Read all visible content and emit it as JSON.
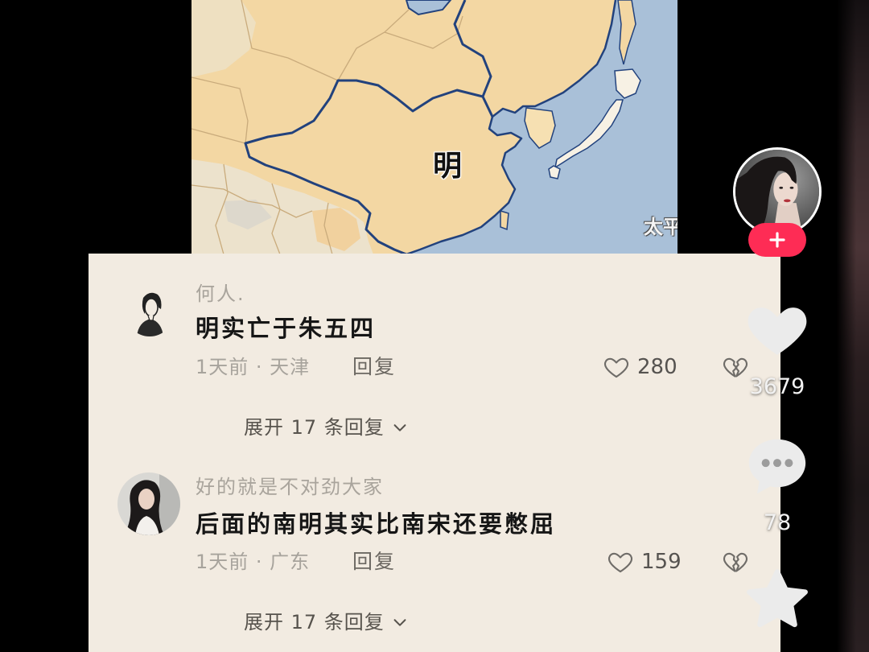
{
  "map": {
    "labels": {
      "ming": "明",
      "pacific": "太平"
    },
    "colors": {
      "land": "#f3d7a3",
      "sea": "#a9c0d8",
      "border": "#22427d"
    }
  },
  "creator": {
    "avatar_icon": "creator-avatar",
    "follow_icon": "plus-icon"
  },
  "sidebar": {
    "like": {
      "icon": "heart-icon",
      "count": "3679"
    },
    "comment": {
      "icon": "comment-bubble-icon",
      "count": "78"
    },
    "favorite": {
      "icon": "star-icon"
    }
  },
  "comments": [
    {
      "username": "何人.",
      "text": "明实亡于朱五四",
      "meta": "1天前 · 天津",
      "reply_label": "回复",
      "likes": "280",
      "expand_label": "展开 17 条回复"
    },
    {
      "username": "好的就是不对劲大家",
      "text": "后面的南明其实比南宋还要憋屈",
      "meta": "1天前 · 广东",
      "reply_label": "回复",
      "likes": "159",
      "expand_label": "展开 17 条回复"
    }
  ],
  "colors": {
    "accent": "#fe2c55",
    "panel_bg": "#f2ebe1",
    "background": "#000000"
  }
}
